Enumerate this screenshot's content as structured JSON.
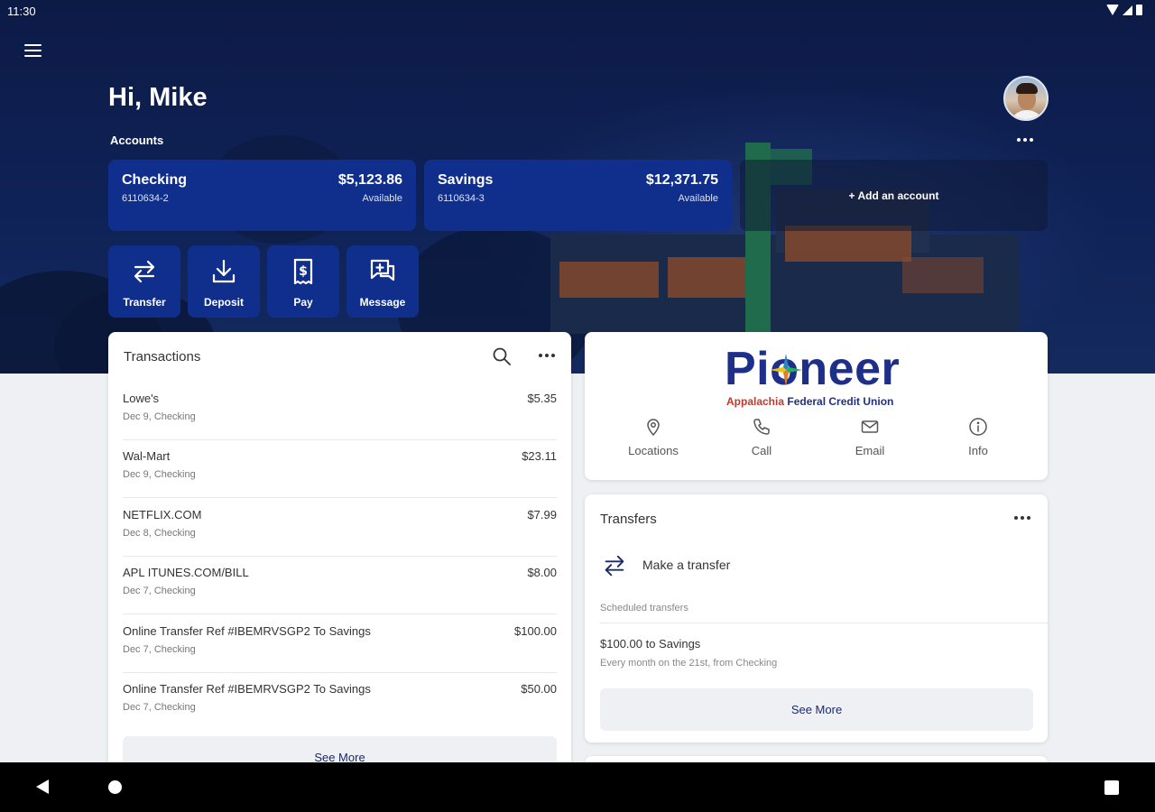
{
  "status": {
    "time": "11:30"
  },
  "header": {
    "greeting": "Hi, Mike",
    "accounts_label": "Accounts"
  },
  "accounts": [
    {
      "name": "Checking",
      "number": "6110634-2",
      "amount": "$5,123.86",
      "sub": "Available"
    },
    {
      "name": "Savings",
      "number": "6110634-3",
      "amount": "$12,371.75",
      "sub": "Available"
    }
  ],
  "add_account_label": "+ Add an account",
  "actions": [
    {
      "label": "Transfer"
    },
    {
      "label": "Deposit"
    },
    {
      "label": "Pay"
    },
    {
      "label": "Message"
    }
  ],
  "transactions": {
    "title": "Transactions",
    "items": [
      {
        "description": "Lowe's",
        "sub": "Dec 9, Checking",
        "amount": "$5.35"
      },
      {
        "description": "Wal-Mart",
        "sub": "Dec 9, Checking",
        "amount": "$23.11"
      },
      {
        "description": "NETFLIX.COM",
        "sub": "Dec 8, Checking",
        "amount": "$7.99"
      },
      {
        "description": "APL ITUNES.COM/BILL",
        "sub": "Dec 7, Checking",
        "amount": "$8.00"
      },
      {
        "description": "Online Transfer Ref #IBEMRVSGP2 To Savings",
        "sub": "Dec 7, Checking",
        "amount": "$100.00"
      },
      {
        "description": "Online Transfer Ref #IBEMRVSGP2 To Savings",
        "sub": "Dec 7, Checking",
        "amount": "$50.00"
      }
    ],
    "see_more": "See More"
  },
  "brand": {
    "name": "Pioneer",
    "subtitle_accent": "Appalachia",
    "subtitle_rest": " Federal Credit Union",
    "links": [
      {
        "label": "Locations",
        "icon": "location-pin-icon"
      },
      {
        "label": "Call",
        "icon": "phone-icon"
      },
      {
        "label": "Email",
        "icon": "email-icon"
      },
      {
        "label": "Info",
        "icon": "info-icon"
      }
    ]
  },
  "transfers": {
    "title": "Transfers",
    "make_transfer": "Make a transfer",
    "scheduled_label": "Scheduled transfers",
    "scheduled": [
      {
        "title": "$100.00 to Savings",
        "detail": "Every month on the 21st, from Checking"
      }
    ],
    "see_more": "See More"
  },
  "colors": {
    "primary": "#102f8d",
    "hero_bg": "#0f2257",
    "page_bg": "#eef0f4",
    "brand_blue": "#1e2f8a",
    "brand_red": "#c0392b"
  }
}
